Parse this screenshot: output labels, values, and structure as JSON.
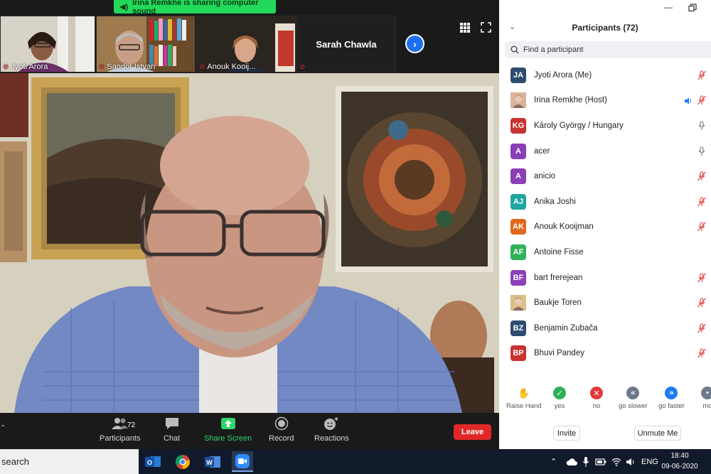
{
  "banner": {
    "text": "Irina Remkhe is sharing computer sound"
  },
  "thumbnails": [
    {
      "name": "Jyoti Arora"
    },
    {
      "name": "Sandor Istvan"
    },
    {
      "name": "Anouk Kooij..."
    },
    {
      "name": "Sarah Chawla"
    }
  ],
  "toolbar": {
    "participants_label": "Participants",
    "participants_count": "72",
    "chat_label": "Chat",
    "share_label": "Share Screen",
    "record_label": "Record",
    "reactions_label": "Reactions",
    "leave_label": "Leave"
  },
  "panel": {
    "title": "Participants (72)",
    "search_placeholder": "Find a participant",
    "participants": [
      {
        "initials": "JA",
        "name": "Jyoti Arora (Me)",
        "color": "#2d4c6e",
        "photo": false,
        "status": "muted",
        "video": false
      },
      {
        "initials": "",
        "name": "Irina Remkhe (Host)",
        "color": "#d9b49a",
        "photo": true,
        "status": "muted",
        "video": true
      },
      {
        "initials": "KG",
        "name": "Károly György / Hungary",
        "color": "#c8322f",
        "photo": false,
        "status": "mic",
        "video": false
      },
      {
        "initials": "A",
        "name": "acer",
        "color": "#8b3fb7",
        "photo": false,
        "status": "mic",
        "video": false
      },
      {
        "initials": "A",
        "name": "anicio",
        "color": "#8b3fb7",
        "photo": false,
        "status": "muted",
        "video": false
      },
      {
        "initials": "AJ",
        "name": "Anika Joshi",
        "color": "#1ea6a0",
        "photo": false,
        "status": "muted",
        "video": false
      },
      {
        "initials": "AK",
        "name": "Anouk Kooijman",
        "color": "#e0681e",
        "photo": false,
        "status": "muted",
        "video": false
      },
      {
        "initials": "AF",
        "name": "Antoine Fisse",
        "color": "#2fb05a",
        "photo": false,
        "status": "none",
        "video": false
      },
      {
        "initials": "BF",
        "name": "bart frerejean",
        "color": "#8b3fb7",
        "photo": false,
        "status": "muted",
        "video": false
      },
      {
        "initials": "",
        "name": "Baukje Toren",
        "color": "#d9c08a",
        "photo": true,
        "status": "muted",
        "video": false
      },
      {
        "initials": "BZ",
        "name": "Benjamin Zubača",
        "color": "#2d4c6e",
        "photo": false,
        "status": "muted",
        "video": false
      },
      {
        "initials": "BP",
        "name": "Bhuvi Pandey",
        "color": "#c8322f",
        "photo": false,
        "status": "muted",
        "video": false
      }
    ],
    "reactions": [
      {
        "label": "Raise Hand",
        "icon": "hand-icon"
      },
      {
        "label": "yes",
        "icon": "check-icon",
        "color": "#2fb05a"
      },
      {
        "label": "no",
        "icon": "x-icon",
        "color": "#e03a3a"
      },
      {
        "label": "go slower",
        "icon": "rewind-icon",
        "color": "#6e7a8a"
      },
      {
        "label": "go faster",
        "icon": "fast-forward-icon",
        "color": "#1e7cf2"
      },
      {
        "label": "mo",
        "icon": "more-icon",
        "color": "#6e7a8a"
      }
    ],
    "invite_label": "Invite",
    "unmute_label": "Unmute Me"
  },
  "taskbar": {
    "search_text": "search",
    "lang": "ENG",
    "time": "18:40",
    "date": "09-06-2020"
  }
}
